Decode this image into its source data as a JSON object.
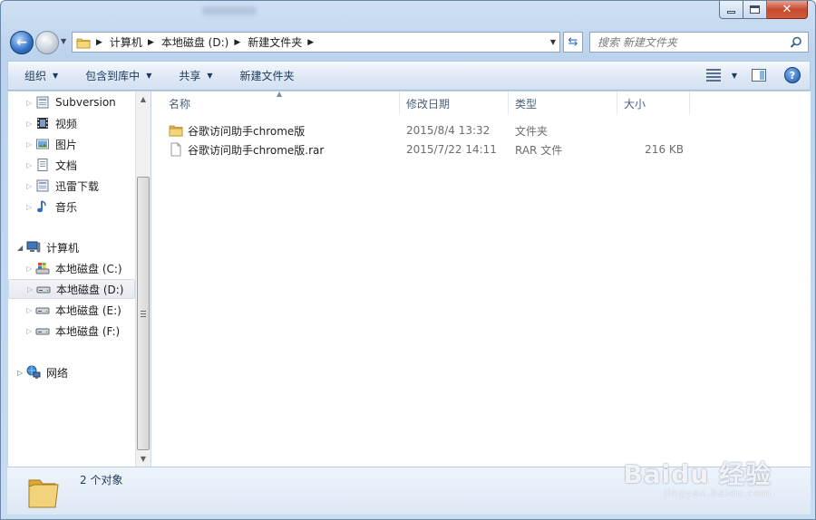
{
  "window": {
    "caption": {
      "close_glyph": "✕"
    }
  },
  "address": {
    "crumbs": [
      {
        "label": "计算机"
      },
      {
        "label": "本地磁盘 (D:)"
      },
      {
        "label": "新建文件夹"
      }
    ]
  },
  "search": {
    "placeholder": "搜索 新建文件夹"
  },
  "toolbar": {
    "organize": "组织",
    "include_in_library": "包含到库中",
    "share": "共享",
    "new_folder": "新建文件夹",
    "help": "?"
  },
  "sidebar": {
    "items": [
      {
        "label": "Subversion",
        "icon": "library-icon"
      },
      {
        "label": "视频",
        "icon": "video-library-icon"
      },
      {
        "label": "图片",
        "icon": "picture-library-icon"
      },
      {
        "label": "文档",
        "icon": "document-library-icon"
      },
      {
        "label": "迅雷下载",
        "icon": "download-library-icon"
      },
      {
        "label": "音乐",
        "icon": "music-library-icon"
      },
      {
        "label": "计算机",
        "icon": "computer-icon"
      },
      {
        "label": "本地磁盘 (C:)",
        "icon": "system-drive-icon"
      },
      {
        "label": "本地磁盘 (D:)",
        "icon": "drive-icon"
      },
      {
        "label": "本地磁盘 (E:)",
        "icon": "drive-icon"
      },
      {
        "label": "本地磁盘 (F:)",
        "icon": "drive-icon"
      },
      {
        "label": "网络",
        "icon": "network-icon"
      }
    ]
  },
  "columns": {
    "name": "名称",
    "date": "修改日期",
    "type": "类型",
    "size": "大小"
  },
  "files": [
    {
      "name": "谷歌访问助手chrome版",
      "date": "2015/8/4 13:32",
      "type": "文件夹",
      "size": "",
      "icon": "folder-icon"
    },
    {
      "name": "谷歌访问助手chrome版.rar",
      "date": "2015/7/22 14:11",
      "type": "RAR 文件",
      "size": "216 KB",
      "icon": "file-icon"
    }
  ],
  "details": {
    "count": "2 个对象"
  },
  "watermark": {
    "main": "Baidu 经验",
    "sub": "jingyan.baidu.com"
  }
}
